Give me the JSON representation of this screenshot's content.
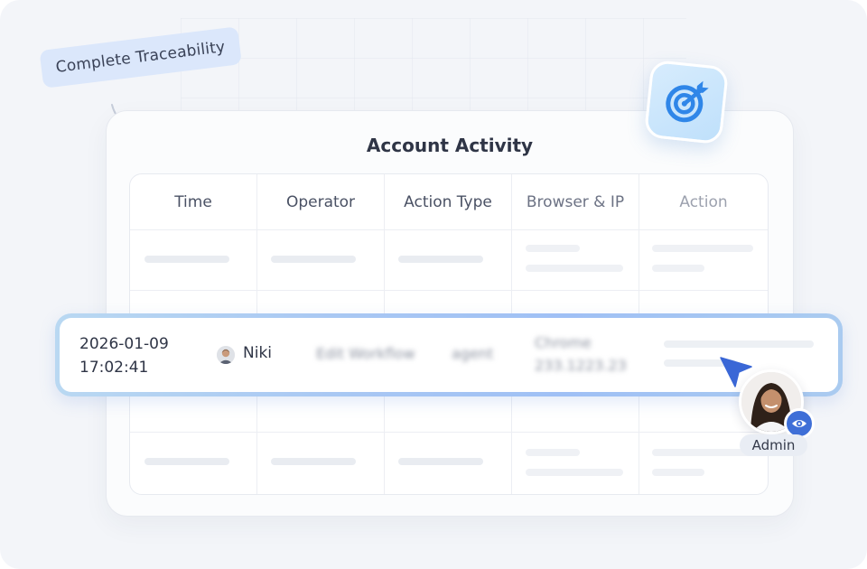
{
  "tag": {
    "label": "Complete Traceability"
  },
  "card": {
    "title": "Account Activity"
  },
  "table": {
    "columns": [
      "Time",
      "Operator",
      "Action Type",
      "Browser & IP",
      "Action"
    ]
  },
  "highlight_row": {
    "time_date": "2026-01-09",
    "time_clock": "17:02:41",
    "operator": "Niki",
    "action_type": "Edit Workflow",
    "action_role": "agent",
    "browser": "Chrome",
    "ip": "233.1223.23"
  },
  "admin": {
    "label": "Admin"
  },
  "icons": {
    "tile": "target-arrow-icon",
    "cursor": "pointer-cursor-icon",
    "eye": "eye-icon"
  },
  "colors": {
    "accent": "#3f6fd7",
    "tag_bg": "#dbe7fb",
    "icon_tile": "#c9e5fc",
    "highlight_border": "#a9c8f3"
  }
}
